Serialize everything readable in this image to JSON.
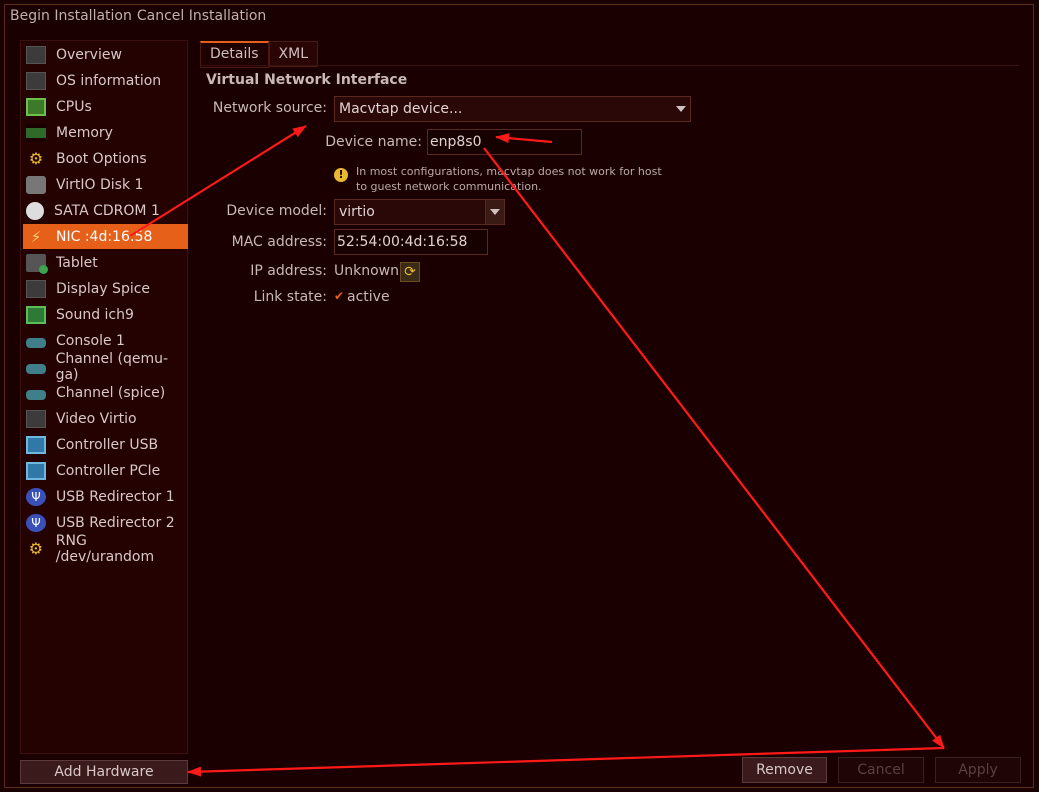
{
  "titlebar": {
    "begin": "Begin Installation",
    "cancel": "Cancel Installation"
  },
  "sidebar": {
    "items": [
      {
        "label": "Overview",
        "icon": "monitor-icon"
      },
      {
        "label": "OS information",
        "icon": "monitor-icon"
      },
      {
        "label": "CPUs",
        "icon": "cpu-icon"
      },
      {
        "label": "Memory",
        "icon": "memory-icon"
      },
      {
        "label": "Boot Options",
        "icon": "gear-icon"
      },
      {
        "label": "VirtIO Disk 1",
        "icon": "disk-icon"
      },
      {
        "label": "SATA CDROM 1",
        "icon": "cdrom-icon"
      },
      {
        "label": "NIC :4d:16:58",
        "icon": "network-icon",
        "selected": true
      },
      {
        "label": "Tablet",
        "icon": "tablet-icon"
      },
      {
        "label": "Display Spice",
        "icon": "monitor-icon"
      },
      {
        "label": "Sound ich9",
        "icon": "sound-card-icon"
      },
      {
        "label": "Console 1",
        "icon": "serial-port-icon"
      },
      {
        "label": "Channel (qemu-ga)",
        "icon": "serial-port-icon"
      },
      {
        "label": "Channel (spice)",
        "icon": "serial-port-icon"
      },
      {
        "label": "Video Virtio",
        "icon": "monitor-icon"
      },
      {
        "label": "Controller USB",
        "icon": "controller-icon"
      },
      {
        "label": "Controller PCIe",
        "icon": "controller-icon"
      },
      {
        "label": "USB Redirector 1",
        "icon": "usb-icon"
      },
      {
        "label": "USB Redirector 2",
        "icon": "usb-icon"
      },
      {
        "label": "RNG /dev/urandom",
        "icon": "gear-icon"
      }
    ],
    "add_hardware": "Add Hardware"
  },
  "tabs": [
    {
      "label": "Details",
      "active": true
    },
    {
      "label": "XML"
    }
  ],
  "section_title": "Virtual Network Interface",
  "form": {
    "network_source_label": "Network source:",
    "network_source_value": "Macvtap device...",
    "device_name_label": "Device name:",
    "device_name_value": "enp8s0",
    "warning": "In most configurations, macvtap does not work for host to guest network communication.",
    "device_model_label": "Device model:",
    "device_model_value": "virtio",
    "mac_label": "MAC address:",
    "mac_value": "52:54:00:4d:16:58",
    "ip_label": "IP address:",
    "ip_value": "Unknown",
    "link_label": "Link state:",
    "link_value": "active",
    "link_checked": true
  },
  "buttons": {
    "remove": "Remove",
    "cancel": "Cancel",
    "apply": "Apply"
  },
  "colors": {
    "accent": "#e6601a",
    "annotation": "#ff0000",
    "background": "#1a0000"
  }
}
